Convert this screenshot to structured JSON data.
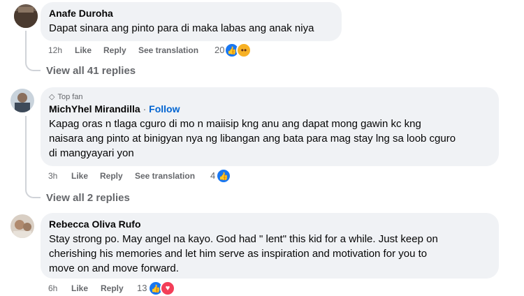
{
  "comments": [
    {
      "author": "Anafe Duroha",
      "text": "Dapat sinara ang pinto para di maka labas ang anak niya",
      "time": "12h",
      "like": "Like",
      "reply": "Reply",
      "translate": "See translation",
      "reaction_count": "20",
      "view_replies": "View all 41 replies"
    },
    {
      "badge": "Top fan",
      "author": "MichYhel Mirandilla",
      "separator": " · ",
      "follow": "Follow",
      "text_lines": [
        "Kapag oras n tlaga cguro di mo n maiisip kng anu ang dapat mong gawin kc kng",
        "naisara ang pinto at binigyan nya ng libangan ang bata para mag stay lng sa loob cguro",
        "di mangyayari yon"
      ],
      "time": "3h",
      "like": "Like",
      "reply": "Reply",
      "translate": "See translation",
      "reaction_count": "4",
      "view_replies": "View all 2 replies"
    },
    {
      "author": "Rebecca Oliva Rufo",
      "text_lines": [
        "Stay strong po. May angel na kayo. God had \" lent\" this kid for a while. Just keep on",
        "cherishing his memories and let him serve as inspiration and motivation for you to",
        "move on and move forward."
      ],
      "time": "6h",
      "like": "Like",
      "reply": "Reply",
      "reaction_count": "13"
    }
  ],
  "icons": {
    "like": "like-icon",
    "wow": "wow-icon",
    "love": "love-icon",
    "top_fan": "diamond-icon"
  },
  "colors": {
    "bubble": "#f0f2f5",
    "secondary_text": "#65676b",
    "follow": "#0064d1",
    "like_blue": "#1877f2"
  }
}
